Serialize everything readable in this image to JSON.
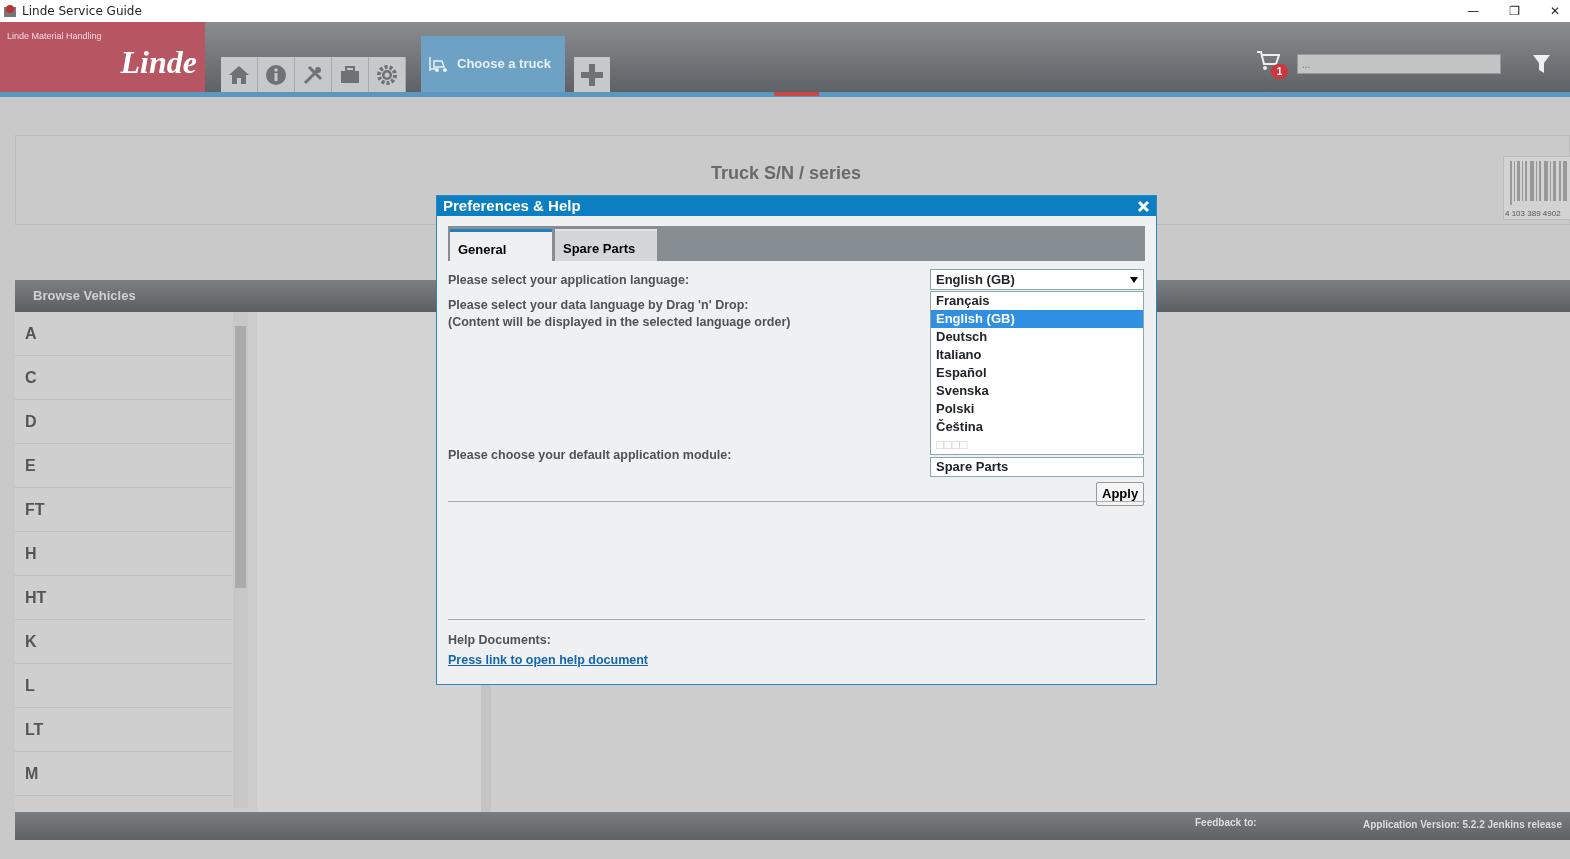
{
  "window": {
    "title": "Linde Service Guide",
    "controls": [
      "—",
      "❐",
      "✕"
    ]
  },
  "header": {
    "brand_caption": "Linde Material Handling",
    "brand_logo": "Linde",
    "toolbar": [
      {
        "kind": "home"
      },
      {
        "kind": "info"
      },
      {
        "kind": "tools"
      },
      {
        "kind": "toolbox"
      },
      {
        "kind": "gear"
      }
    ],
    "tabs": [
      {
        "label": "Choose a truck",
        "selected": true
      }
    ],
    "cart_badge": "1",
    "search": {
      "placeholder": "..."
    }
  },
  "truck_search": {
    "title": "Truck S/N / series",
    "barcode_number": "4 103 389 4902"
  },
  "browse": {
    "title": "Browse Vehicles",
    "items": [
      "A",
      "C",
      "D",
      "E",
      "FT",
      "H",
      "HT",
      "K",
      "L",
      "LT",
      "M"
    ]
  },
  "footer": {
    "feedback": "Feedback to:",
    "version": "Application Version: 5.2.2 Jenkins release"
  },
  "dialog": {
    "title": "Preferences & Help",
    "tabs": [
      {
        "label": "General",
        "selected": true
      },
      {
        "label": "Spare Parts",
        "selected": false
      }
    ],
    "app_language_label": "Please select your application language:",
    "app_language_value": "English (GB)",
    "languages": [
      {
        "label": "Français",
        "selected": false,
        "disabled": false
      },
      {
        "label": "English (GB)",
        "selected": true,
        "disabled": false
      },
      {
        "label": "Deutsch",
        "selected": false,
        "disabled": false
      },
      {
        "label": "Italiano",
        "selected": false,
        "disabled": false
      },
      {
        "label": "Español",
        "selected": false,
        "disabled": false
      },
      {
        "label": "Svenska",
        "selected": false,
        "disabled": false
      },
      {
        "label": "Polski",
        "selected": false,
        "disabled": false
      },
      {
        "label": "Čeština",
        "selected": false,
        "disabled": false
      },
      {
        "label": "□□□□",
        "selected": false,
        "disabled": true
      }
    ],
    "data_language_label": "Please select your data language by Drag 'n' Drop:",
    "data_language_note": "(Content will be displayed in the selected language order)",
    "module_label": "Please choose your default application module:",
    "module_value": "Spare Parts",
    "apply_button": "Apply",
    "help_title": "Help Documents:",
    "help_link": "Press link to open help document"
  }
}
